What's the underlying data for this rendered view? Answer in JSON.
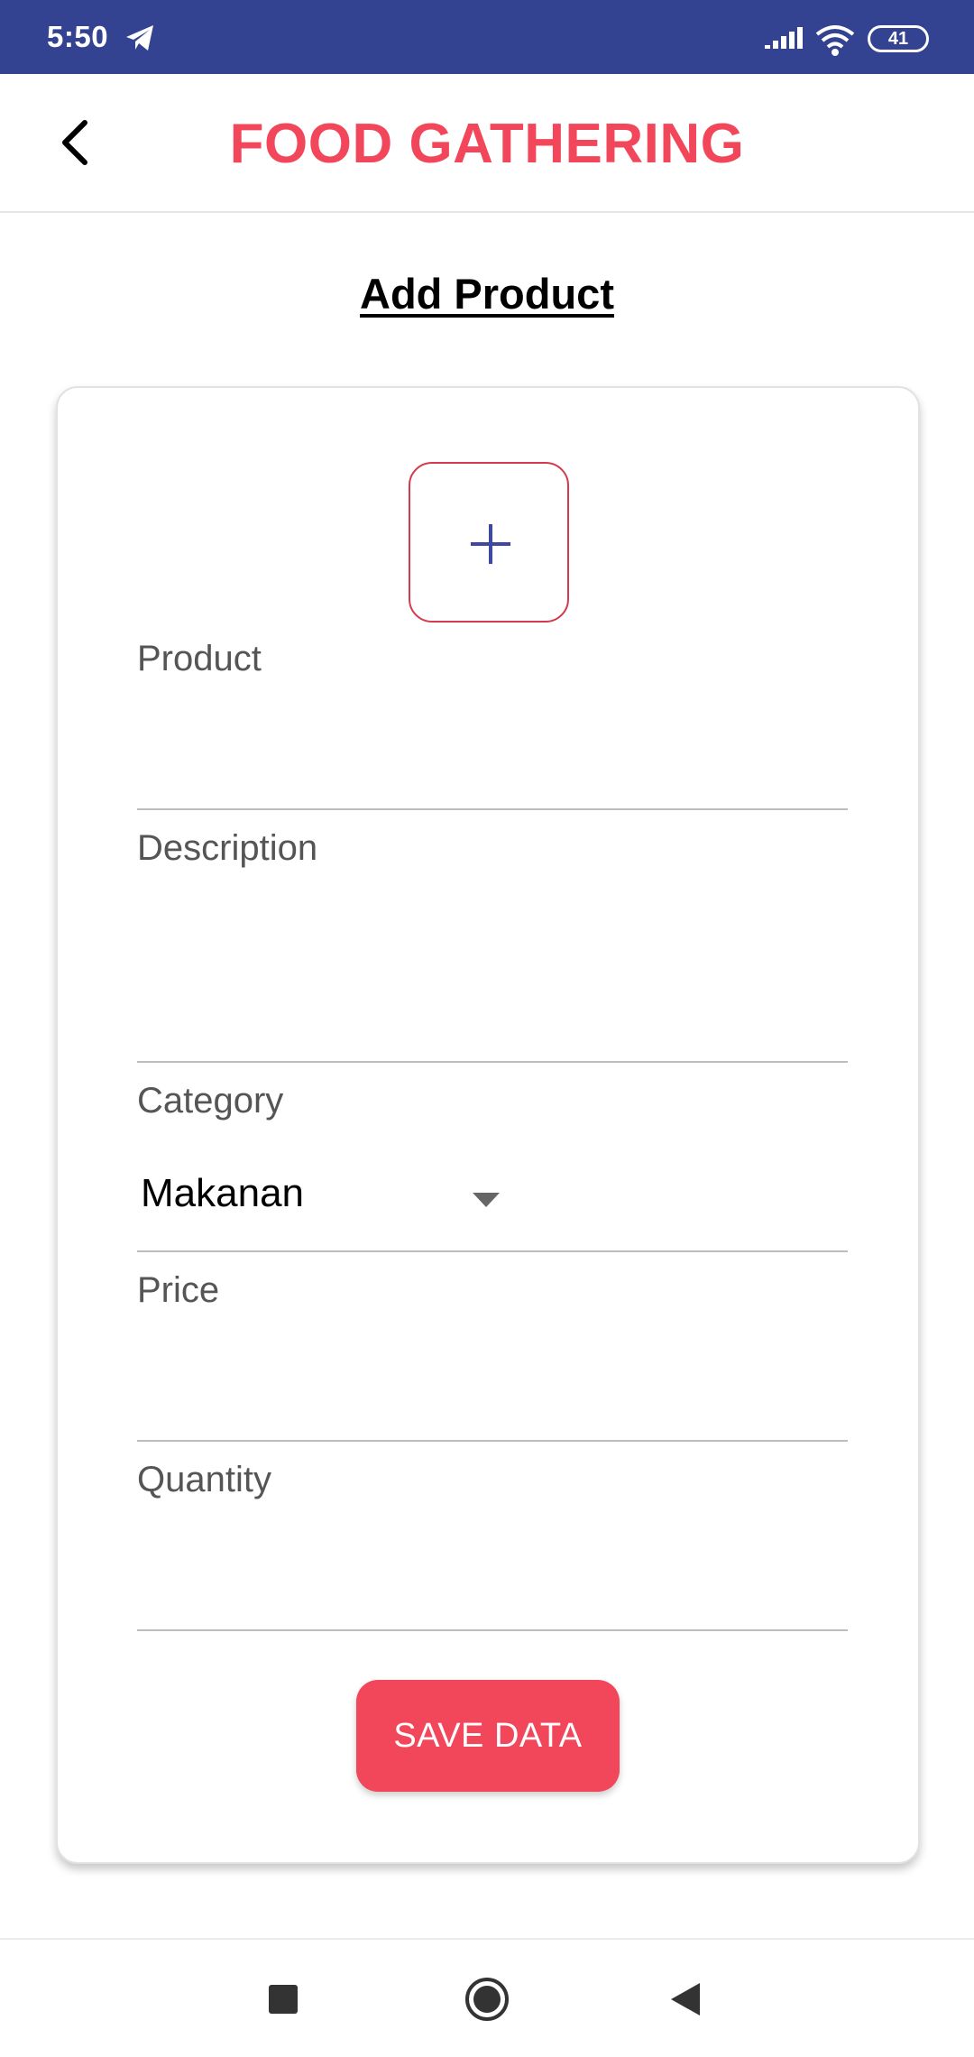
{
  "status_bar": {
    "time": "5:50",
    "battery": "41",
    "background": "#334291"
  },
  "app_bar": {
    "title": "FOOD GATHERING",
    "title_color": "#f2475b"
  },
  "page": {
    "heading": "Add Product"
  },
  "form": {
    "add_image_symbol": "+",
    "fields": {
      "product": {
        "label": "Product",
        "value": ""
      },
      "description": {
        "label": "Description",
        "value": ""
      },
      "category": {
        "label": "Category",
        "selected": "Makanan"
      },
      "price": {
        "label": "Price",
        "value": ""
      },
      "quantity": {
        "label": "Quantity",
        "value": ""
      }
    },
    "save_label": "SAVE DATA",
    "accent_color": "#f2475b"
  },
  "icons": {
    "status": [
      "telegram-icon",
      "signal-icon",
      "wifi-icon",
      "battery-icon"
    ],
    "app_bar": [
      "back-arrow-icon"
    ],
    "nav": [
      "recents-square-icon",
      "home-circle-icon",
      "back-triangle-icon"
    ]
  }
}
